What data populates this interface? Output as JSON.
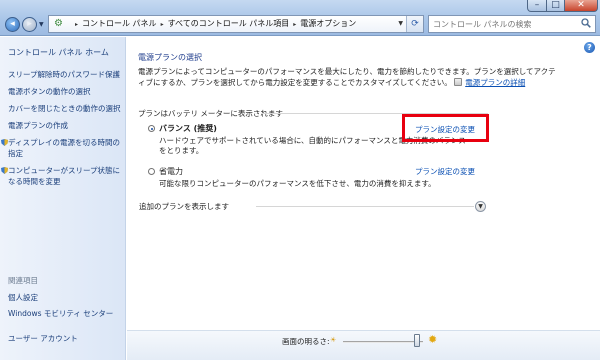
{
  "window": {
    "minimize_glyph": "–",
    "maximize_glyph": "□",
    "close_glyph": "✕"
  },
  "address_bar": {
    "breadcrumbs": [
      "コントロール パネル",
      "すべてのコントロール パネル項目",
      "電源オプション"
    ],
    "separator": "▸"
  },
  "search": {
    "placeholder": "コントロール パネルの検索"
  },
  "left_pane": {
    "home": "コントロール パネル ホーム",
    "links": [
      "スリープ解除時のパスワード保護",
      "電源ボタンの動作の選択",
      "カバーを閉じたときの動作の選択",
      "電源プランの作成",
      "ディスプレイの電源を切る時間の指定",
      "コンピューターがスリープ状態になる時間を変更"
    ],
    "related_heading": "関連項目",
    "related": [
      "個人設定",
      "Windows モビリティ センター",
      "ユーザー アカウント"
    ]
  },
  "main": {
    "title": "電源プランの選択",
    "description": "電源プランによってコンピューターのパフォーマンスを最大にしたり、電力を節約したりできます。プランを選択してアクティブにするか、プランを選択してから電力設定を変更することでカスタマイズしてください。",
    "more_link": "電源プランの詳細",
    "group_heading": "プランはバッテリ メーターに表示されます",
    "plans": [
      {
        "name": "バランス (推奨)",
        "selected": true,
        "change_link": "プラン設定の変更",
        "description": "ハードウェアでサポートされている場合に、自動的にパフォーマンスと電力消費のバランスをとります。"
      },
      {
        "name": "省電力",
        "selected": false,
        "change_link": "プラン設定の変更",
        "description": "可能な限りコンピューターのパフォーマンスを低下させ、電力の消費を抑えます。"
      }
    ],
    "show_more": "追加のプランを表示します"
  },
  "brightness": {
    "label": "画面の明るさ:",
    "level_fraction": 0.92
  },
  "colors": {
    "link": "#0a4fb3",
    "highlight_box": "#e8000f",
    "title_blue": "#1e3c8c"
  },
  "icons": {
    "back": "back-arrow-icon",
    "forward": "forward-arrow-icon",
    "refresh": "refresh-icon",
    "search": "search-icon",
    "help": "help-icon",
    "shield": "shield-icon",
    "sun": "sun-icon"
  }
}
